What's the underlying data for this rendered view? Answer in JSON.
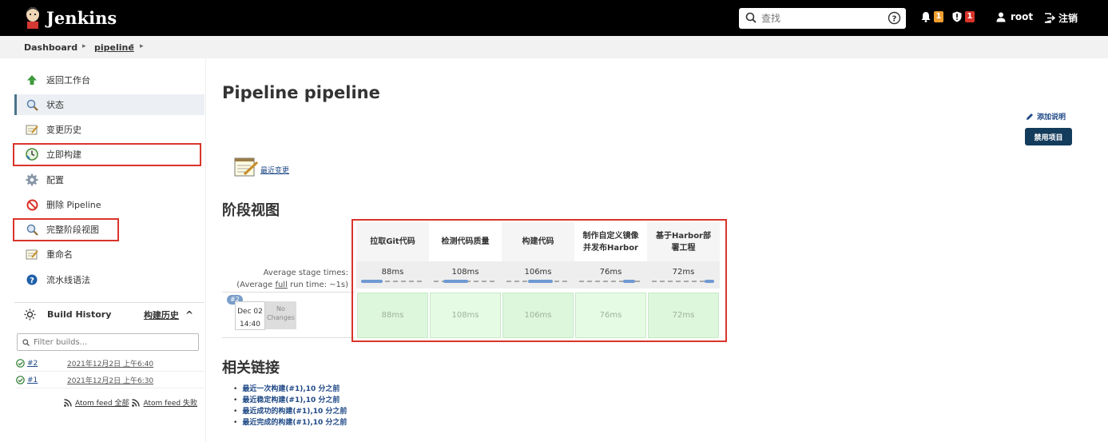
{
  "header": {
    "brand": "Jenkins",
    "search_placeholder": "查找",
    "notifications_count": "1",
    "security_count": "1",
    "user": "root",
    "logout": "注销"
  },
  "breadcrumb": {
    "items": [
      "Dashboard",
      "pipeline"
    ]
  },
  "sidebar": {
    "items": [
      {
        "label": "返回工作台",
        "icon": "up-arrow-icon"
      },
      {
        "label": "状态",
        "icon": "magnifier-icon"
      },
      {
        "label": "变更历史",
        "icon": "notepad-icon"
      },
      {
        "label": "立即构建",
        "icon": "clock-build-icon"
      },
      {
        "label": "配置",
        "icon": "gear-icon"
      },
      {
        "label": "删除 Pipeline",
        "icon": "no-entry-icon"
      },
      {
        "label": "完整阶段视图",
        "icon": "magnifier-icon"
      },
      {
        "label": "重命名",
        "icon": "notepad-icon"
      },
      {
        "label": "流水线语法",
        "icon": "help-icon"
      }
    ],
    "build_history": {
      "title": "Build History",
      "history_link": "构建历史",
      "filter_placeholder": "Filter builds...",
      "builds": [
        {
          "number": "#2",
          "time": "2021年12月2日 上午6:40"
        },
        {
          "number": "#1",
          "time": "2021年12月2日 上午6:30"
        }
      ],
      "feed_all": "Atom feed 全部",
      "feed_fail": "Atom feed 失败"
    }
  },
  "main": {
    "title": "Pipeline pipeline",
    "add_description": "添加说明",
    "disable_button": "禁用项目",
    "recent_changes": "最近变更",
    "stage_view_title": "阶段视图",
    "avg_stage_times_label": "Average stage times:",
    "avg_run_time_prefix": "(Average ",
    "avg_run_time_full": "full",
    "avg_run_time_suffix": " run time: ~1s)",
    "stages": [
      {
        "name": "拉取Git代码",
        "avg": "88ms",
        "bar": [
          0.0,
          0.35
        ],
        "run": "88ms"
      },
      {
        "name": "检测代码质量",
        "avg": "108ms",
        "bar": [
          0.15,
          0.55
        ],
        "run": "108ms"
      },
      {
        "name": "构建代码",
        "avg": "106ms",
        "bar": [
          0.35,
          0.75
        ],
        "run": "106ms"
      },
      {
        "name": "制作自定义镜像并发布Harbor",
        "avg": "76ms",
        "bar": [
          0.7,
          0.9
        ],
        "run": "76ms"
      },
      {
        "name": "基于Harbor部署工程",
        "avg": "72ms",
        "bar": [
          0.85,
          1.0
        ],
        "run": "72ms"
      }
    ],
    "build": {
      "number": "#2",
      "date": "Dec 02",
      "time": "14:40",
      "changes": "No Changes"
    },
    "related_title": "相关链接",
    "related_links": [
      "最近一次构建(#1),10 分之前",
      "最近稳定构建(#1),10 分之前",
      "最近成功的构建(#1),10 分之前",
      "最近完成的构建(#1),10 分之前"
    ]
  }
}
